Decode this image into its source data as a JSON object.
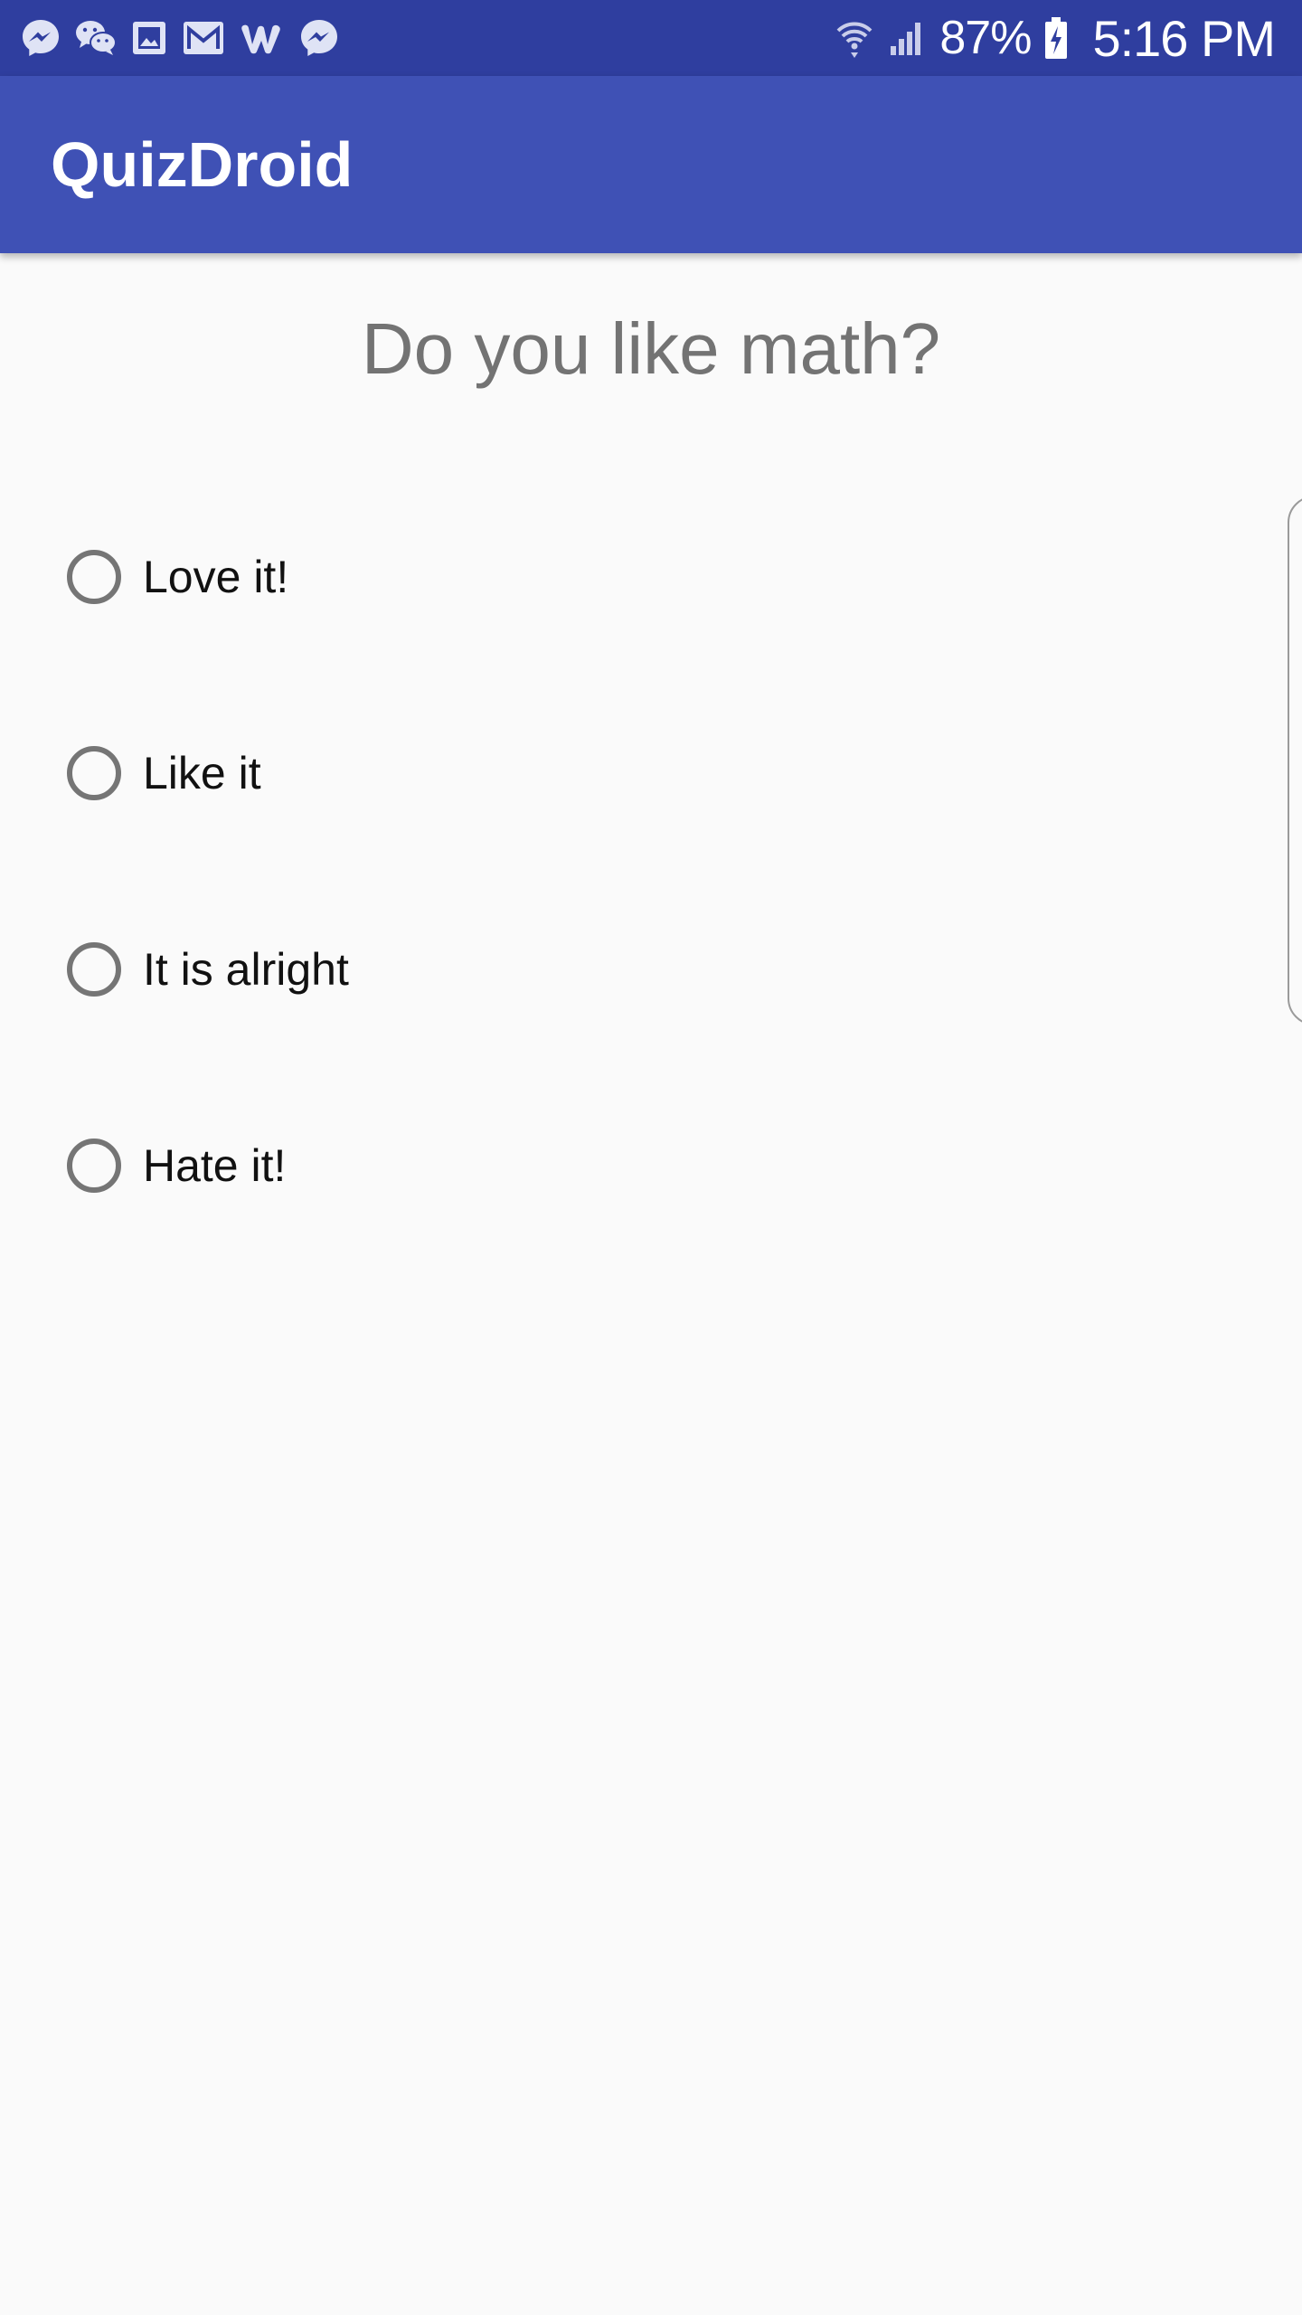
{
  "status_bar": {
    "notification_icons": [
      "messenger-icon",
      "wechat-icon",
      "gallery-icon",
      "gmail-icon",
      "wattpad-icon",
      "messenger-icon"
    ],
    "battery_percent": "87%",
    "time": "5:16 PM"
  },
  "app_bar": {
    "title": "QuizDroid"
  },
  "question": {
    "text": "Do you like math?"
  },
  "options": [
    {
      "label": "Love it!"
    },
    {
      "label": "Like it"
    },
    {
      "label": "It is alright"
    },
    {
      "label": "Hate it!"
    }
  ],
  "colors": {
    "status_bar": "#2f3e9f",
    "app_bar": "#3f51b5",
    "background": "#fafafa",
    "question_text": "#737373",
    "radio": "#757575"
  }
}
